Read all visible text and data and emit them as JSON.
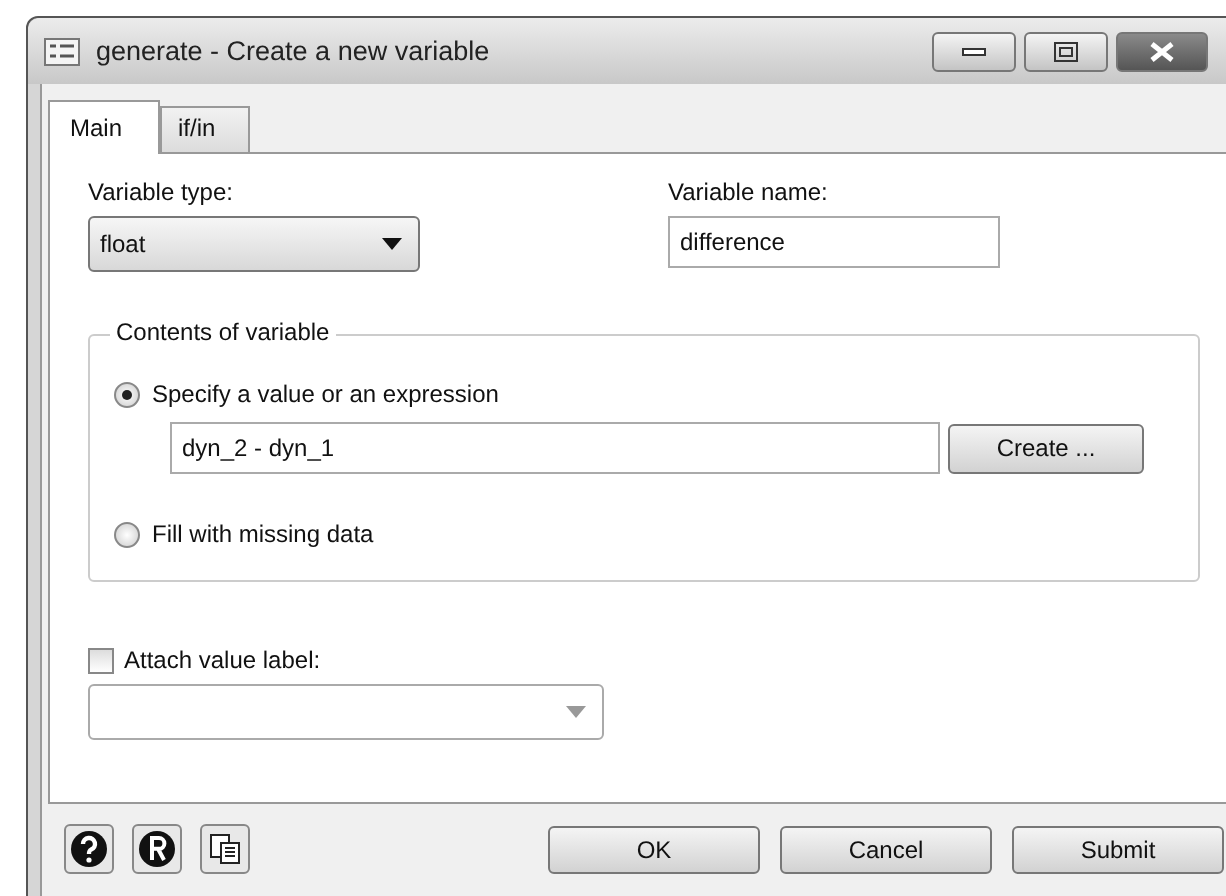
{
  "window": {
    "title": "generate - Create a new variable"
  },
  "tabs": [
    {
      "label": "Main",
      "selected": true
    },
    {
      "label": "if/in",
      "selected": false
    }
  ],
  "variable_type": {
    "label": "Variable type:",
    "value": "float"
  },
  "variable_name": {
    "label": "Variable name:",
    "value": "difference"
  },
  "contents": {
    "title": "Contents of variable",
    "options": [
      {
        "label": "Specify a value or an expression",
        "selected": true
      },
      {
        "label": "Fill with missing data",
        "selected": false
      }
    ],
    "expression": {
      "value": "dyn_2 - dyn_1"
    },
    "create_button": "Create ..."
  },
  "value_label": {
    "label": "Attach value label:",
    "checked": false,
    "disabled": true
  },
  "buttons": [
    "OK",
    "Cancel",
    "Submit"
  ]
}
